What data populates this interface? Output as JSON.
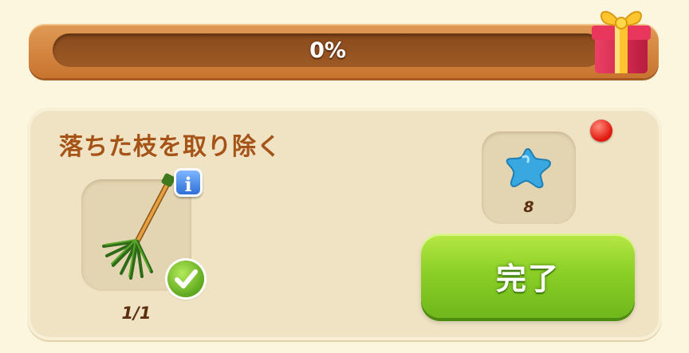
{
  "progress": {
    "percent": 0,
    "label": "0%"
  },
  "gift": {
    "icon": "gift-box-icon"
  },
  "task": {
    "title": "落ちた枝を取り除く",
    "item": {
      "icon": "rake-icon",
      "count_text": "1/1",
      "completed": true
    },
    "reward": {
      "icon": "blue-star-icon",
      "amount": "8"
    },
    "complete_button_label": "完了",
    "has_notification": true
  },
  "colors": {
    "title": "#a65318",
    "button": "#8cd028",
    "notification": "#e21a10"
  }
}
